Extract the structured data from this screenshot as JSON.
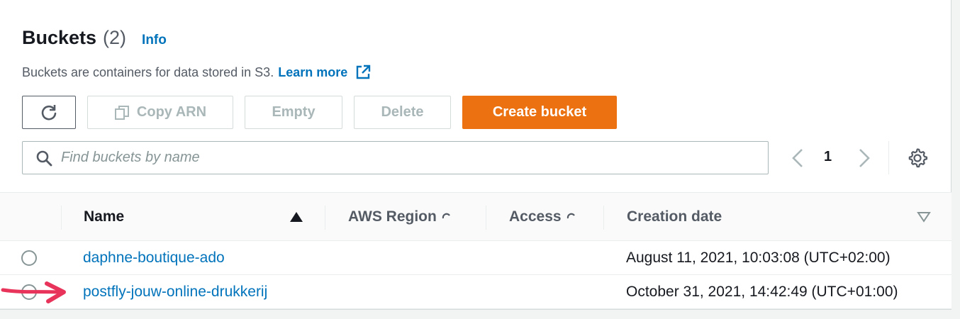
{
  "header": {
    "title": "Buckets",
    "count": "(2)",
    "info_link": "Info",
    "description": "Buckets are containers for data stored in S3.",
    "learn_more": "Learn more"
  },
  "toolbar": {
    "refresh_icon": "refresh-icon",
    "copy_arn": "Copy ARN",
    "empty": "Empty",
    "delete": "Delete",
    "create_bucket": "Create bucket"
  },
  "search": {
    "placeholder": "Find buckets by name",
    "value": ""
  },
  "pagination": {
    "current_page": "1"
  },
  "table": {
    "columns": {
      "name": "Name",
      "region": "AWS Region",
      "access": "Access",
      "creation_date": "Creation date"
    },
    "rows": [
      {
        "name": "daphne-boutique-ado",
        "creation_date": "August 11, 2021, 10:03:08 (UTC+02:00)"
      },
      {
        "name": "postfly-jouw-online-drukkerij",
        "creation_date": "October 31, 2021, 14:42:49 (UTC+01:00)"
      }
    ]
  },
  "colors": {
    "primary_button": "#ec7211",
    "link": "#0073bb",
    "annotation_arrow": "#e8345a"
  }
}
